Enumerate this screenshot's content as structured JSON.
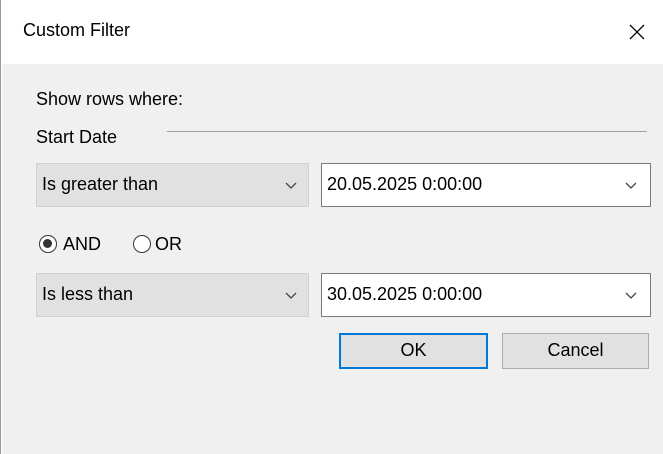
{
  "window": {
    "title": "Custom Filter",
    "close_icon": "close-icon"
  },
  "filter": {
    "prompt": "Show rows where:",
    "column_name": "Start Date",
    "condition1": {
      "operator": "Is greater than",
      "value": "20.05.2025 0:00:00"
    },
    "logic": {
      "and_label": "AND",
      "or_label": "OR",
      "selected": "AND"
    },
    "condition2": {
      "operator": "Is less than",
      "value": "30.05.2025 0:00:00"
    }
  },
  "buttons": {
    "ok_label": "OK",
    "cancel_label": "Cancel"
  },
  "colors": {
    "accent": "#0078d7",
    "dialog_background": "#f0f0f0"
  }
}
